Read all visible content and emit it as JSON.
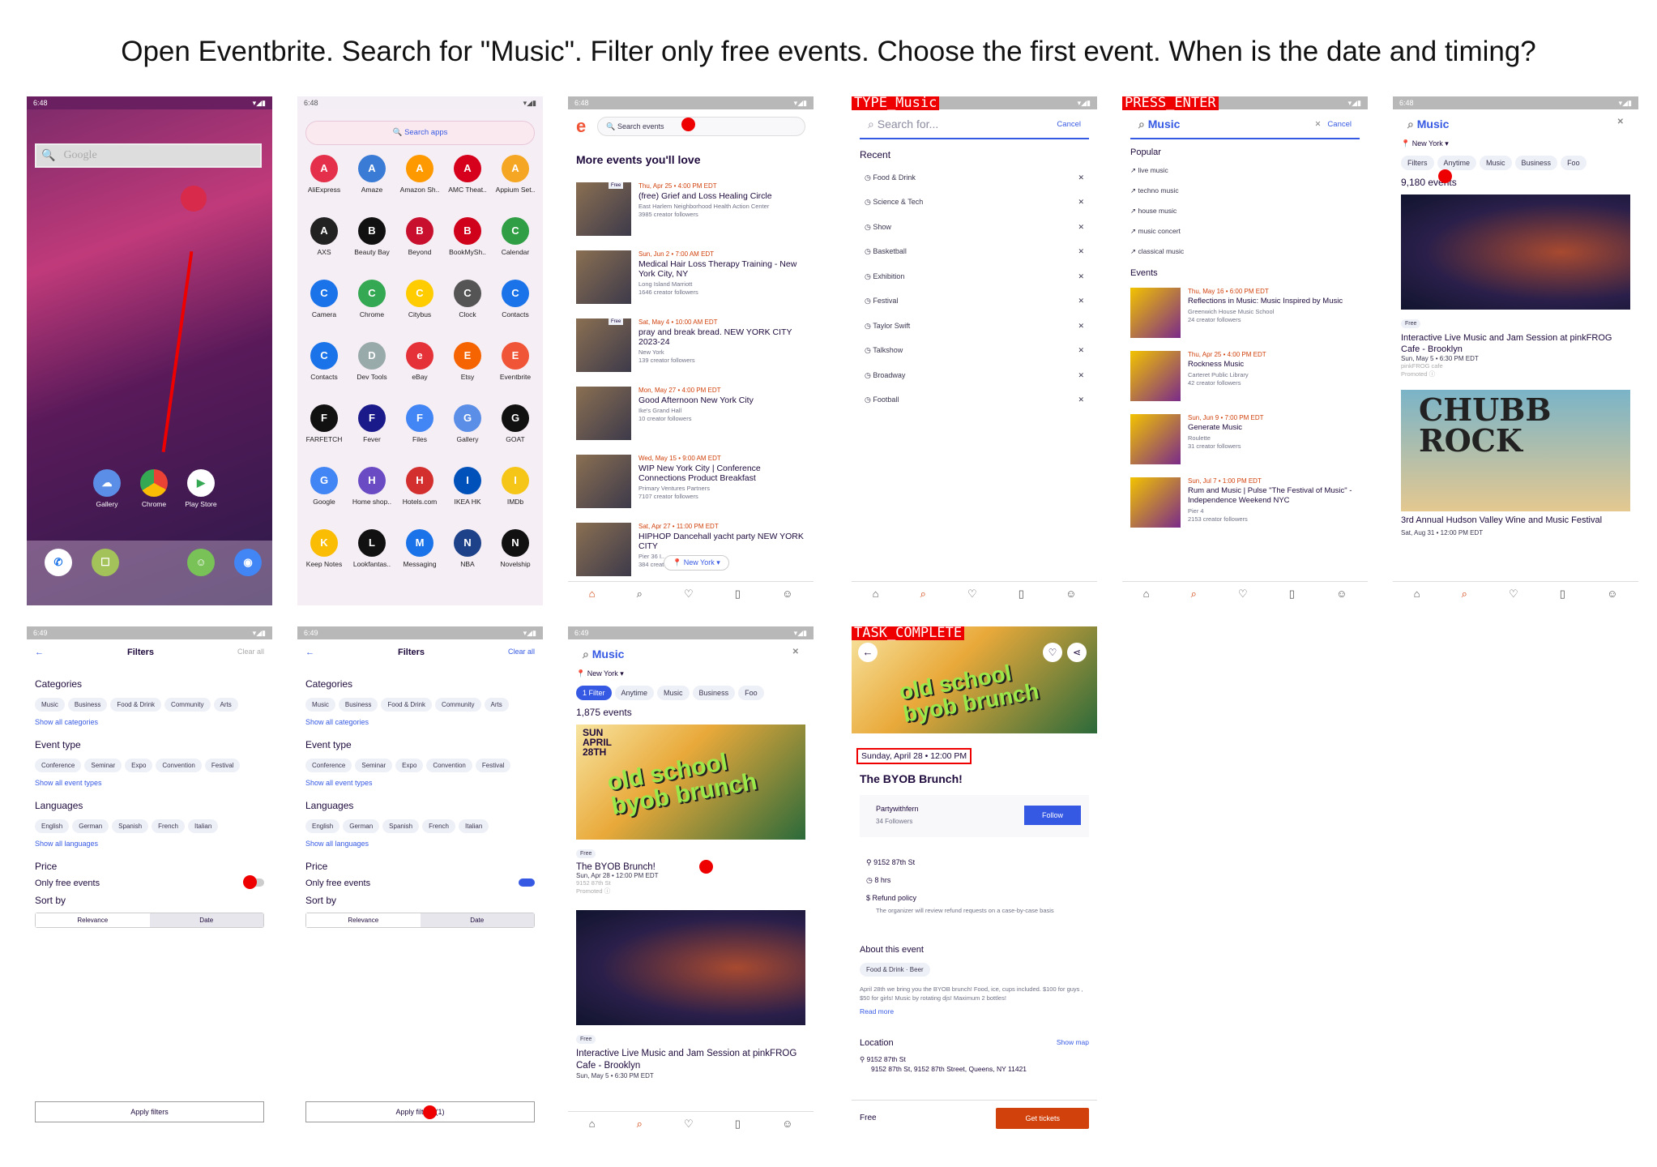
{
  "task": "Open Eventbrite. Search for \"Music\". Filter only free events. Choose the first event. When is the date and timing?",
  "status_time": "6:48",
  "status_time2": "6:49",
  "s1": {
    "search_ph": "Google",
    "apps": [
      "Gallery",
      "Chrome",
      "Play Store"
    ]
  },
  "s2": {
    "search": "Search apps",
    "apps": [
      "AliExpress",
      "Amaze",
      "Amazon Sh..",
      "AMC Theat..",
      "Appium Set..",
      "AXS",
      "Beauty Bay",
      "Beyond",
      "BookMySh..",
      "Calendar",
      "Camera",
      "Chrome",
      "Citybus",
      "Clock",
      "Contacts",
      "Contacts",
      "Dev Tools",
      "eBay",
      "Etsy",
      "Eventbrite",
      "FARFETCH",
      "Fever",
      "Files",
      "Gallery",
      "GOAT",
      "Google",
      "Home shop..",
      "Hotels.com",
      "IKEA HK",
      "IMDb",
      "Keep Notes",
      "Lookfantas..",
      "Messaging",
      "NBA",
      "Novelship"
    ]
  },
  "s3": {
    "search": "Search events",
    "heading": "More events you'll love",
    "events": [
      {
        "date": "Thu, Apr 25 • 4:00 PM EDT",
        "title": "(free) Grief and Loss Healing Circle",
        "venue": "East Harlem Neighborhood Health Action Center",
        "followers": "3985 creator followers",
        "badge": "Free"
      },
      {
        "date": "Sun, Jun 2 • 7:00 AM EDT",
        "title": "Medical Hair Loss Therapy Training - New York City, NY",
        "venue": "Long Island Marriott",
        "followers": "1646 creator followers",
        "badge": ""
      },
      {
        "date": "Sat, May 4 • 10:00 AM EDT",
        "title": "pray and break bread. NEW YORK CITY 2023-24",
        "venue": "New York",
        "followers": "139 creator followers",
        "badge": "Free"
      },
      {
        "date": "Mon, May 27 • 4:00 PM EDT",
        "title": "Good Afternoon New York City",
        "venue": "Ike's Grand Hall",
        "followers": "10 creator followers",
        "badge": ""
      },
      {
        "date": "Wed, May 15 • 9:00 AM EDT",
        "title": "WIP New York City | Conference Connections Product Breakfast",
        "venue": "Primary Ventures Partners",
        "followers": "7107 creator followers",
        "badge": ""
      },
      {
        "date": "Sat, Apr 27 • 11:00 PM EDT",
        "title": "HIPHOP Dancehall yacht party NEW YORK CITY",
        "venue": "Pier 36 I..",
        "followers": "384 creator followers",
        "badge": ""
      }
    ],
    "loc": "New York"
  },
  "s4": {
    "action": "TYPE_Music",
    "ph": "Search for...",
    "cancel": "Cancel",
    "recent_label": "Recent",
    "recent": [
      "Food & Drink",
      "Science & Tech",
      "Show",
      "Basketball",
      "Exhibition",
      "Festival",
      "Taylor Swift",
      "Talkshow",
      "Broadway",
      "Football"
    ]
  },
  "s5": {
    "action": "PRESS_ENTER",
    "query": "Music",
    "cancel": "Cancel",
    "popular_label": "Popular",
    "popular": [
      "live music",
      "techno music",
      "house music",
      "music concert",
      "classical music"
    ],
    "events_label": "Events",
    "events": [
      {
        "date": "Thu, May 16 • 6:00 PM EDT",
        "title": "Reflections in Music: Music Inspired by Music",
        "venue": "Greenwich House Music School",
        "followers": "24 creator followers"
      },
      {
        "date": "Thu, Apr 25 • 4:00 PM EDT",
        "title": "Rockness Music",
        "venue": "Carteret Public Library",
        "followers": "42 creator followers"
      },
      {
        "date": "Sun, Jun 9 • 7:00 PM EDT",
        "title": "Generate Music",
        "venue": "Roulette",
        "followers": "31 creator followers"
      },
      {
        "date": "Sun, Jul 7 • 1:00 PM EDT",
        "title": "Rum and Music | Pulse \"The Festival of Music\" - Independence Weekend NYC",
        "venue": "Pier 4",
        "followers": "2153 creator followers"
      }
    ]
  },
  "s6": {
    "query": "Music",
    "loc": "New York",
    "chips": [
      "Filters",
      "Anytime",
      "Music",
      "Business",
      "Foo"
    ],
    "count": "9,180 events",
    "e1": {
      "badge": "Free",
      "title": "Interactive Live Music and Jam Session at pinkFROG Cafe - Brooklyn",
      "date": "Sun, May 5 • 6:30 PM EDT",
      "venue": "pinkFROG cafe",
      "promo": "Promoted ⓘ"
    },
    "e2": {
      "title": "3rd Annual Hudson Valley Wine and Music Festival",
      "date": "Sat, Aug 31 • 12:00 PM EDT",
      "banner": "CHUBB ROCK"
    }
  },
  "filters": {
    "title": "Filters",
    "clear": "Clear all",
    "cat_label": "Categories",
    "cats": [
      "Music",
      "Business",
      "Food & Drink",
      "Community",
      "Arts"
    ],
    "show_cats": "Show all categories",
    "type_label": "Event type",
    "types": [
      "Conference",
      "Seminar",
      "Expo",
      "Convention",
      "Festival"
    ],
    "show_types": "Show all event types",
    "lang_label": "Languages",
    "langs": [
      "English",
      "German",
      "Spanish",
      "French",
      "Italian"
    ],
    "show_langs": "Show all languages",
    "price_label": "Price",
    "free_label": "Only free events",
    "sort_label": "Sort by",
    "sort": [
      "Relevance",
      "Date"
    ],
    "apply": "Apply filters",
    "apply2": "Apply filters (1)"
  },
  "s9": {
    "query": "Music",
    "loc": "New York",
    "chips": [
      "1 Filter",
      "Anytime",
      "Music",
      "Business",
      "Foo"
    ],
    "count": "1,875 events",
    "e1": {
      "badge": "Free",
      "title": "The BYOB Brunch!",
      "date": "Sun, Apr 28 • 12:00 PM EDT",
      "venue": "9152 87th St",
      "promo": "Promoted ⓘ",
      "art": "old school byob brunch",
      "art_date": "SUN APRIL 28TH"
    },
    "e2": {
      "badge": "Free",
      "title": "Interactive Live Music and Jam Session at pinkFROG Cafe - Brooklyn",
      "date": "Sun, May 5 • 6:30 PM EDT"
    }
  },
  "s10": {
    "action": "TASK_COMPLETE",
    "date": "Sunday, April 28 • 12:00 PM",
    "title": "The BYOB Brunch!",
    "org": "Partywithfern",
    "org_f": "34 Followers",
    "follow": "Follow",
    "addr": "9152 87th St",
    "dur": "8 hrs",
    "refund": "Refund policy",
    "refund_note": "The organizer will review refund requests on a case-by-case basis",
    "about": "About this event",
    "tag": "Food & Drink · Beer",
    "desc": "April 28th we bring you the BYOB brunch! Food, ice, cups included. $100 for guys , $50 for girls! Music by rotating djs! Maximum 2 bottles!",
    "read": "Read more",
    "loc_label": "Location",
    "map": "Show map",
    "loc1": "9152 87th St",
    "loc2": "9152 87th St, 9152 87th Street, Queens, NY 11421",
    "price": "Free",
    "tickets": "Get tickets"
  }
}
